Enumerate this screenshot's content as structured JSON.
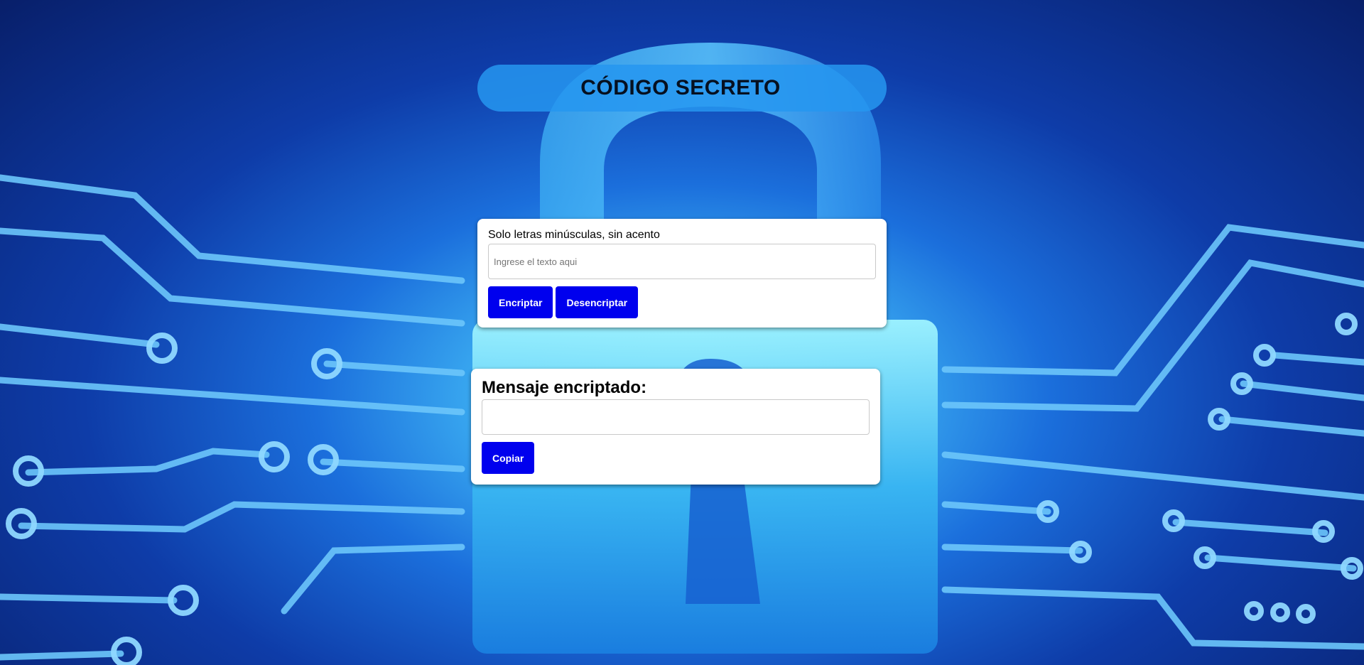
{
  "header": {
    "title": "CÓDIGO SECRETO"
  },
  "encrypt_panel": {
    "hint": "Solo letras minúsculas, sin acento",
    "input_value": "",
    "input_placeholder": "Ingrese el texto aqui",
    "encrypt_label": "Encriptar",
    "decrypt_label": "Desencriptar"
  },
  "result_panel": {
    "title": "Mensaje encriptado:",
    "output_value": "",
    "copy_label": "Copiar"
  },
  "colors": {
    "button_bg": "#0000ee",
    "title_bar_bg": "#2696f0"
  },
  "background": {
    "icon": "padlock-circuit-background"
  }
}
